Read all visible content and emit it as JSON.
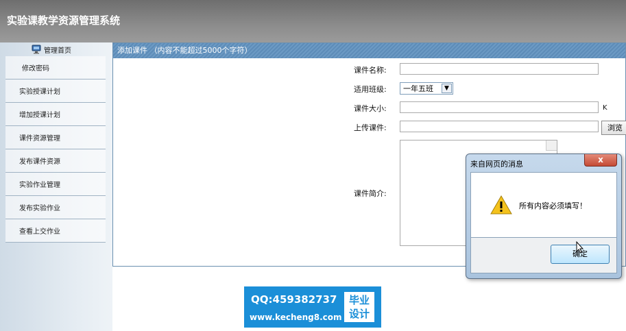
{
  "app": {
    "title": "实验课教学资源管理系统"
  },
  "sidebar": {
    "home_label": "管理首页",
    "items": [
      {
        "label": "修改密码"
      },
      {
        "label": "实验授课计划"
      },
      {
        "label": "增加授课计划"
      },
      {
        "label": "课件资源管理"
      },
      {
        "label": "发布课件资源"
      },
      {
        "label": "实验作业管理"
      },
      {
        "label": "发布实验作业"
      },
      {
        "label": "查看上交作业"
      }
    ]
  },
  "panel": {
    "title": "添加课件 （内容不能超过5000个字符）"
  },
  "form": {
    "name_label": "课件名称:",
    "name_value": "",
    "class_label": "适用班级:",
    "class_value": "一年五班",
    "size_label": "课件大小:",
    "size_value": "",
    "size_unit": "K",
    "upload_label": "上传课件:",
    "upload_value": "",
    "browse_label": "浏览",
    "intro_label": "课件简介:",
    "intro_value": ""
  },
  "dialog": {
    "title": "来自网页的消息",
    "close_label": "x",
    "message": "所有内容必须填写！",
    "ok_label": "确定"
  },
  "watermark": {
    "qq": "QQ:459382737",
    "url": "www.kecheng8.com",
    "box_line1": "毕业",
    "box_line2": "设计"
  },
  "icons": {
    "home": "monitor-icon",
    "warning": "warning-icon",
    "cursor": "mouse-cursor-icon"
  },
  "colors": {
    "panel_header": "#5d8cb8",
    "topbar": "#7a7a7a",
    "watermark": "#1b8fd8"
  }
}
